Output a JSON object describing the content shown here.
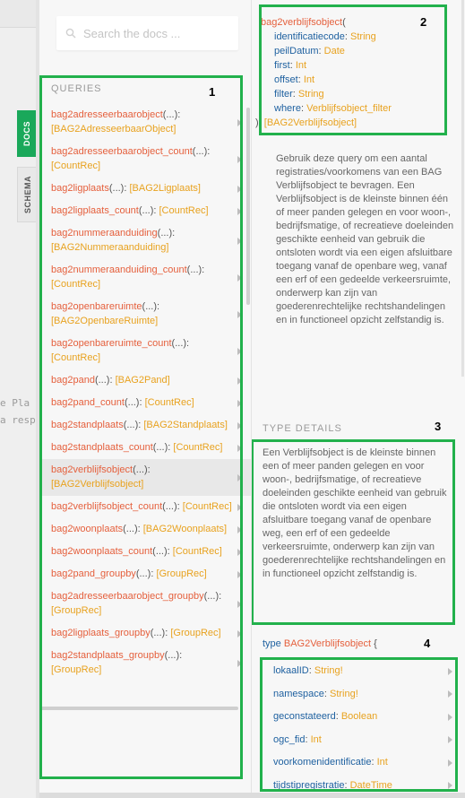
{
  "editor": {
    "ghost_lines": [
      "e Pla",
      "a resp"
    ]
  },
  "tabs": [
    {
      "label": "DOCS",
      "active": true
    },
    {
      "label": "SCHEMA",
      "active": false
    }
  ],
  "search": {
    "placeholder": "Search the docs ...",
    "value": ""
  },
  "queries": {
    "title": "QUERIES",
    "items": [
      {
        "name": "bag2adresseerbaarobject",
        "args": "(...)",
        "sep": ": ",
        "type": "[BAG2AdresseerbaarObject]",
        "selected": false
      },
      {
        "name": "bag2adresseerbaarobject_count",
        "args": "(...)",
        "sep": ": ",
        "type": "[CountRec]",
        "selected": false
      },
      {
        "name": "bag2ligplaats",
        "args": "(...)",
        "sep": ": ",
        "type": "[BAG2Ligplaats]",
        "selected": false
      },
      {
        "name": "bag2ligplaats_count",
        "args": "(...)",
        "sep": ": ",
        "type": "[CountRec]",
        "selected": false
      },
      {
        "name": "bag2nummeraanduiding",
        "args": "(...)",
        "sep": ": ",
        "type": "[BAG2Nummeraanduiding]",
        "selected": false
      },
      {
        "name": "bag2nummeraanduiding_count",
        "args": "(...)",
        "sep": ": ",
        "type": "[CountRec]",
        "selected": false
      },
      {
        "name": "bag2openbareruimte",
        "args": "(...)",
        "sep": ": ",
        "type": "[BAG2OpenbareRuimte]",
        "selected": false
      },
      {
        "name": "bag2openbareruimte_count",
        "args": "(...)",
        "sep": ": ",
        "type": "[CountRec]",
        "selected": false
      },
      {
        "name": "bag2pand",
        "args": "(...)",
        "sep": ": ",
        "type": "[BAG2Pand]",
        "selected": false
      },
      {
        "name": "bag2pand_count",
        "args": "(...)",
        "sep": ": ",
        "type": "[CountRec]",
        "selected": false
      },
      {
        "name": "bag2standplaats",
        "args": "(...)",
        "sep": ": ",
        "type": "[BAG2Standplaats]",
        "selected": false
      },
      {
        "name": "bag2standplaats_count",
        "args": "(...)",
        "sep": ": ",
        "type": "[CountRec]",
        "selected": false
      },
      {
        "name": "bag2verblijfsobject",
        "args": "(...)",
        "sep": ": ",
        "type": "[BAG2Verblijfsobject]",
        "selected": true
      },
      {
        "name": "bag2verblijfsobject_count",
        "args": "(...)",
        "sep": ": ",
        "type": "[CountRec]",
        "selected": false
      },
      {
        "name": "bag2woonplaats",
        "args": "(...)",
        "sep": ": ",
        "type": "[BAG2Woonplaats]",
        "selected": false
      },
      {
        "name": "bag2woonplaats_count",
        "args": "(...)",
        "sep": ": ",
        "type": "[CountRec]",
        "selected": false
      },
      {
        "name": "bag2pand_groupby",
        "args": "(...)",
        "sep": ": ",
        "type": "[GroupRec]",
        "selected": false
      },
      {
        "name": "bag2adresseerbaarobject_groupby",
        "args": "(...)",
        "sep": ": ",
        "type": "[GroupRec]",
        "selected": false
      },
      {
        "name": "bag2ligplaats_groupby",
        "args": "(...)",
        "sep": ": ",
        "type": "[GroupRec]",
        "selected": false
      },
      {
        "name": "bag2standplaats_groupby",
        "args": "(...)",
        "sep": ": ",
        "type": "[GroupRec]",
        "selected": false
      }
    ]
  },
  "signature": {
    "name": "bag2verblijfsobject",
    "open": "(",
    "args": [
      {
        "name": "identificatiecode",
        "type": "String"
      },
      {
        "name": "peilDatum",
        "type": "Date"
      },
      {
        "name": "first",
        "type": "Int"
      },
      {
        "name": "offset",
        "type": "Int"
      },
      {
        "name": "filter",
        "type": "String"
      },
      {
        "name": "where",
        "type": "Verblijfsobject_filter"
      }
    ],
    "close": "): ",
    "return_type": "[BAG2Verblijfsobject]"
  },
  "description": "Gebruik deze query om een aantal registraties/voorkomens van een BAG Verblijfsobject te bevragen. Een Verblijfsobject is de kleinste binnen één of meer panden gelegen en voor woon-, bedrijfsmatige, of recreatieve doeleinden geschikte eenheid van gebruik die ontsloten wordt via een eigen afsluitbare toegang vanaf de openbare weg, vanaf een erf of een gedeelde verkeersruimte, onderwerp kan zijn van goederenrechtelijke rechtshandelingen en in functioneel opzicht zelfstandig is.",
  "type_details": {
    "title": "TYPE DETAILS",
    "text": "Een Verblijfsobject is de kleinste binnen een of meer panden gelegen en voor woon-, bedrijfsmatige, of recreatieve doeleinden geschikte eenheid van gebruik die ontsloten wordt via een eigen afsluitbare toegang vanaf de openbare weg, een erf of een gedeelde verkeersruimte, onderwerp kan zijn van goederenrechtelijke rechtshandelingen en in functioneel opzicht zelfstandig is.",
    "type_keyword": "type",
    "type_name": "BAG2Verblijfsobject",
    "brace": "{",
    "fields": [
      {
        "name": "lokaalID",
        "sep": ": ",
        "type": "String!"
      },
      {
        "name": "namespace",
        "sep": ": ",
        "type": "String!"
      },
      {
        "name": "geconstateerd",
        "sep": ": ",
        "type": "Boolean"
      },
      {
        "name": "ogc_fid",
        "sep": ": ",
        "type": "Int"
      },
      {
        "name": "voorkomenidentificatie",
        "sep": ": ",
        "type": "Int"
      },
      {
        "name": "tijdstipregistratie",
        "sep": ": ",
        "type": "DateTime"
      }
    ]
  },
  "annotations": [
    "1",
    "2",
    "3",
    "4"
  ],
  "colors": {
    "highlight_box": "#22b14c",
    "field_name": "#e5603d",
    "type_name": "#e8a21f",
    "arg_name": "#1f61a0",
    "tab_active": "#1aa85a"
  }
}
